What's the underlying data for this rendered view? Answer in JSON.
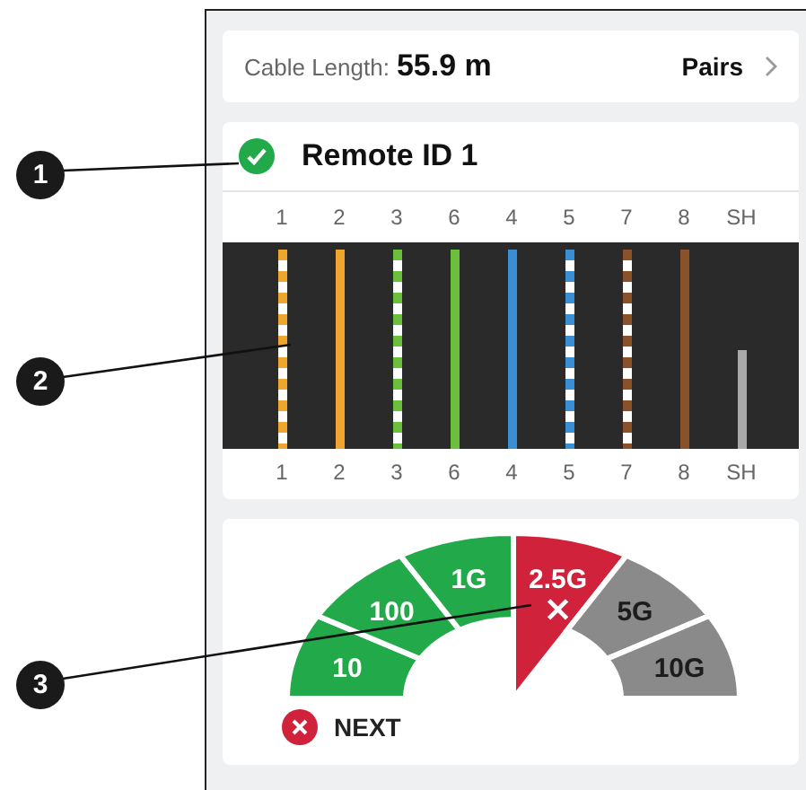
{
  "callouts": [
    {
      "label": "1"
    },
    {
      "label": "2"
    },
    {
      "label": "3"
    }
  ],
  "cable": {
    "label": "Cable Length:",
    "value": "55.9 m",
    "link": "Pairs"
  },
  "remote": {
    "passed": true,
    "title": "Remote ID 1"
  },
  "wires": [
    {
      "top_label": "1",
      "bottom_label": "1",
      "kind": "striped",
      "color": "#f0a531"
    },
    {
      "top_label": "2",
      "bottom_label": "2",
      "kind": "solid",
      "color": "#f0a531"
    },
    {
      "top_label": "3",
      "bottom_label": "3",
      "kind": "striped",
      "color": "#6cbf3c"
    },
    {
      "top_label": "6",
      "bottom_label": "6",
      "kind": "solid",
      "color": "#6cbf3c"
    },
    {
      "top_label": "4",
      "bottom_label": "4",
      "kind": "solid",
      "color": "#3a8fd4"
    },
    {
      "top_label": "5",
      "bottom_label": "5",
      "kind": "striped",
      "color": "#3a8fd4"
    },
    {
      "top_label": "7",
      "bottom_label": "7",
      "kind": "striped",
      "color": "#8a5228"
    },
    {
      "top_label": "8",
      "bottom_label": "8",
      "kind": "solid",
      "color": "#8a5228"
    },
    {
      "top_label": "SH",
      "bottom_label": "SH",
      "kind": "shield",
      "color": "#a9a9a9"
    }
  ],
  "speed": {
    "segments": [
      {
        "label": "10",
        "color": "#22a94a",
        "tested": true,
        "failed": false
      },
      {
        "label": "100",
        "color": "#22a94a",
        "tested": true,
        "failed": false
      },
      {
        "label": "1G",
        "color": "#22a94a",
        "tested": true,
        "failed": false
      },
      {
        "label": "2.5G",
        "color": "#d0223a",
        "tested": true,
        "failed": true
      },
      {
        "label": "5G",
        "color": "#8a8a8a",
        "tested": false,
        "failed": false
      },
      {
        "label": "10G",
        "color": "#8a8a8a",
        "tested": false,
        "failed": false
      }
    ],
    "legend": {
      "failed": true,
      "label": "NEXT"
    }
  }
}
